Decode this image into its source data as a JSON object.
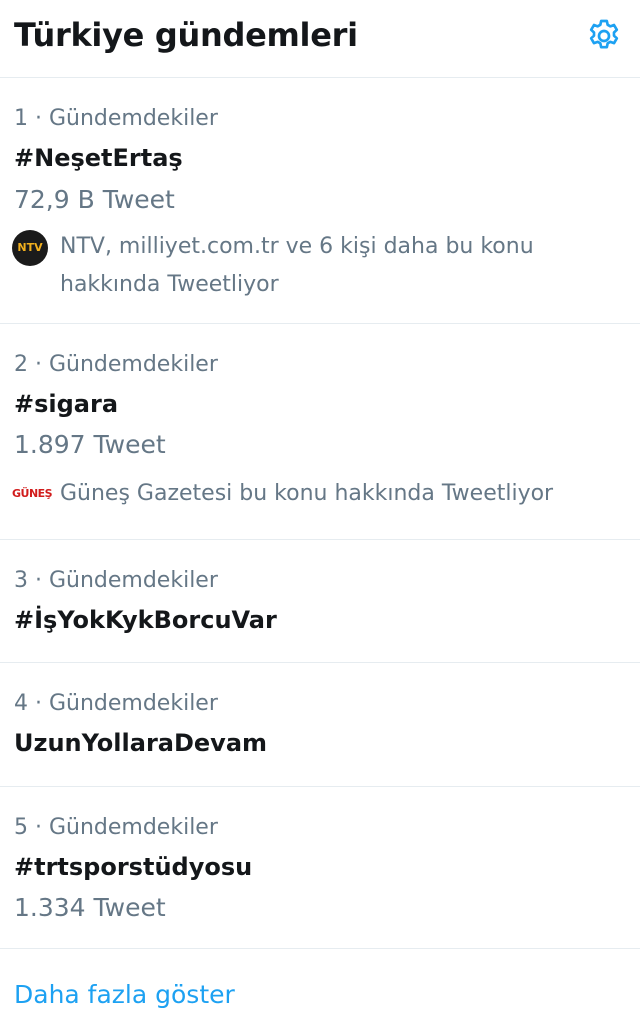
{
  "header": {
    "title": "Türkiye gündemleri",
    "settings_icon": "gear-icon",
    "accent": "#1da1f2"
  },
  "trends": [
    {
      "meta": "1 · Gündemdekiler",
      "name": "#NeşetErtaş",
      "count": "72,9 B Tweet",
      "context_line1": "NTV, milliyet.com.tr ve 6 kişi daha bu konu",
      "context_line2": "hakkında Tweetliyor",
      "avatar_text": "NTV"
    },
    {
      "meta": "2 · Gündemdekiler",
      "name": "#sigara",
      "count": "1.897 Tweet",
      "context_line1": "Güneş Gazetesi bu konu hakkında Tweetliyor",
      "avatar_text": "GÜNEŞ"
    },
    {
      "meta": "3 · Gündemdekiler",
      "name": "#İşYokKykBorcuVar"
    },
    {
      "meta": "4 · Gündemdekiler",
      "name": "UzunYollaraDevam"
    },
    {
      "meta": "5 · Gündemdekiler",
      "name": "#trtsporstüdyosu",
      "count": "1.334 Tweet"
    }
  ],
  "footer": {
    "show_more": "Daha fazla göster"
  }
}
